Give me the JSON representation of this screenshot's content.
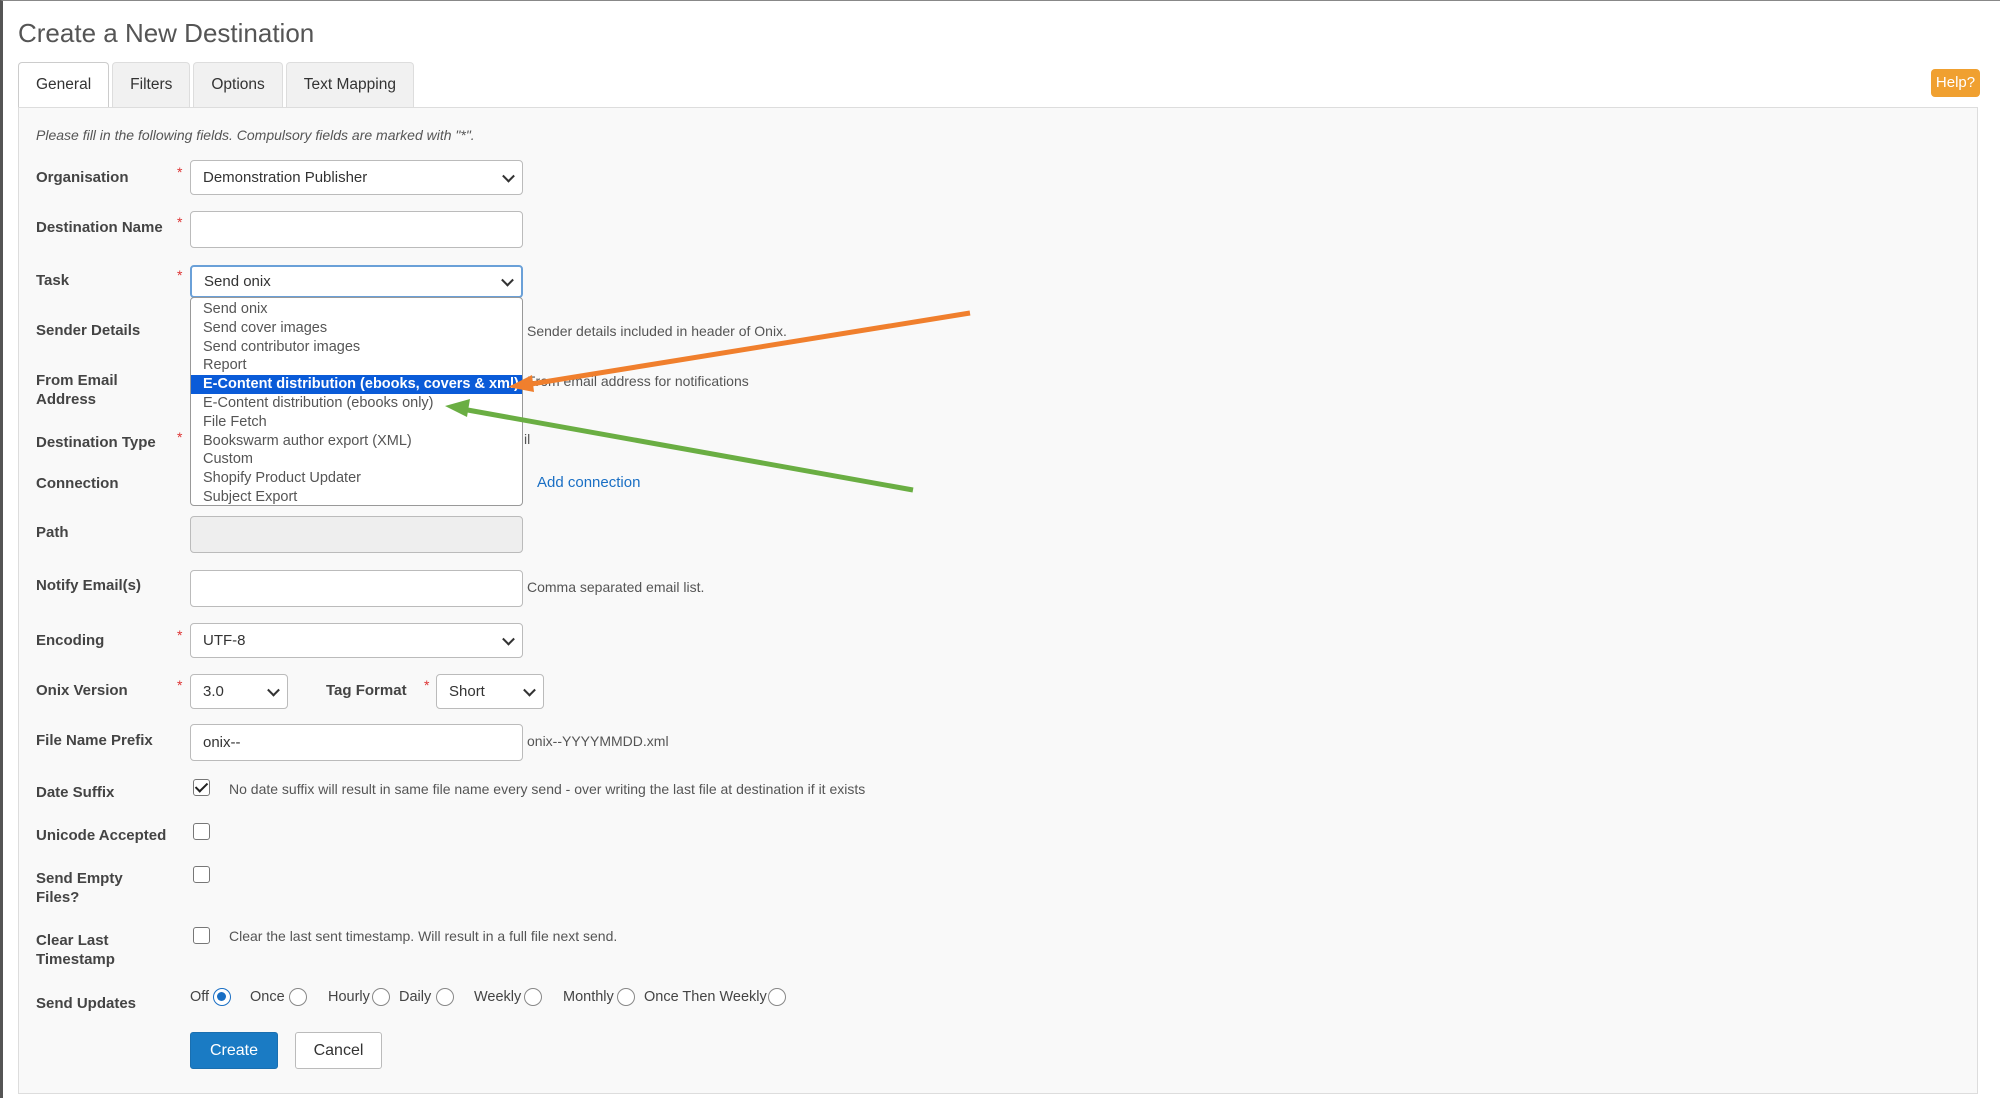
{
  "page": {
    "title": "Create a New Destination"
  },
  "tabs": [
    {
      "label": "General",
      "active": true
    },
    {
      "label": "Filters",
      "active": false
    },
    {
      "label": "Options",
      "active": false
    },
    {
      "label": "Text Mapping",
      "active": false
    }
  ],
  "help_label": "Help?",
  "hint": "Please fill in the following fields. Compulsory fields are marked with \"*\".",
  "required_mark": "*",
  "form": {
    "organisation": {
      "label": "Organisation",
      "value": "Demonstration Publisher"
    },
    "destination_name": {
      "label": "Destination Name",
      "value": ""
    },
    "task": {
      "label": "Task",
      "value": "Send onix"
    },
    "sender_details": {
      "label": "Sender Details",
      "help": "Sender details included in header of Onix."
    },
    "from_email": {
      "label": "From Email Address",
      "help": "From email address for notifications"
    },
    "destination_type": {
      "label": "Destination Type",
      "help_fragment": "il"
    },
    "connection": {
      "label": "Connection",
      "link": "Add connection"
    },
    "path": {
      "label": "Path",
      "value": ""
    },
    "notify": {
      "label": "Notify Email(s)",
      "value": "",
      "help": "Comma separated email list."
    },
    "encoding": {
      "label": "Encoding",
      "value": "UTF-8"
    },
    "onix_version": {
      "label": "Onix Version",
      "value": "3.0"
    },
    "tag_format": {
      "label": "Tag Format",
      "value": "Short"
    },
    "file_prefix": {
      "label": "File Name Prefix",
      "value": "onix--",
      "help": "onix--YYYYMMDD.xml"
    },
    "date_suffix": {
      "label": "Date Suffix",
      "checked": true,
      "help": "No date suffix will result in same file name every send - over writing the last file at destination if it exists"
    },
    "unicode": {
      "label": "Unicode Accepted",
      "checked": false
    },
    "send_empty": {
      "label": "Send Empty Files?",
      "checked": false
    },
    "clear_last": {
      "label": "Clear Last Timestamp",
      "checked": false,
      "help": "Clear the last sent timestamp. Will result in a full file next send."
    },
    "send_updates": {
      "label": "Send Updates",
      "options": [
        "Off",
        "Once",
        "Hourly",
        "Daily",
        "Weekly",
        "Monthly",
        "Once Then Weekly"
      ],
      "selected": "Off"
    }
  },
  "task_options": [
    "Send onix",
    "Send cover images",
    "Send contributor images",
    "Report",
    "E-Content distribution (ebooks, covers & xml)",
    "E-Content distribution (ebooks only)",
    "File Fetch",
    "Bookswarm author export (XML)",
    "Custom",
    "Shopify Product Updater",
    "Subject Export"
  ],
  "highlighted_option": "E-Content distribution (ebooks, covers & xml)",
  "buttons": {
    "create": "Create",
    "cancel": "Cancel"
  },
  "colors": {
    "primary": "#1a7bc4",
    "help": "#f0a030",
    "arrow_orange": "#f07f2d",
    "arrow_green": "#6aae43",
    "highlight": "#0a5bd8"
  }
}
